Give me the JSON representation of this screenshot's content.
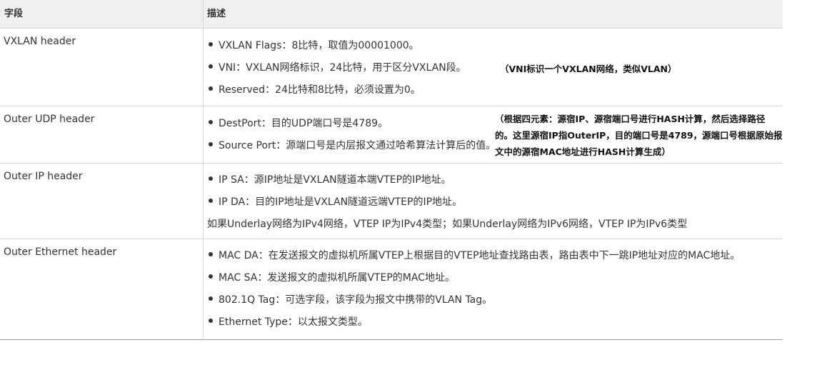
{
  "table": {
    "headers": {
      "field": "字段",
      "description": "描述"
    },
    "rows": [
      {
        "field": "VXLAN header",
        "bullets": [
          "VXLAN Flags：8比特，取值为00001000。",
          "VNI：VXLAN网络标识，24比特，用于区分VXLAN段。",
          "Reserved：24比特和8比特，必须设置为0。"
        ],
        "note": "（VNI标识一个VXLAN网络，类似VLAN）"
      },
      {
        "field": "Outer UDP header",
        "bullets": [
          "DestPort：目的UDP端口号是4789。",
          "Source Port：源端口号是内层报文通过哈希算法计算后的值。"
        ],
        "note_lines": [
          "（根据四元素：源宿IP、源宿端口号进行HASH计算，然后选择路径",
          "的。这里源宿IP指OuterIP，目的端口号是4789，源端口号根据原始报",
          "文中的源宿MAC地址进行HASH计算生成）"
        ]
      },
      {
        "field": "Outer IP header",
        "bullets": [
          "IP SA：源IP地址是VXLAN隧道本端VTEP的IP地址。",
          "IP DA：目的IP地址是VXLAN隧道远端VTEP的IP地址。"
        ],
        "extra": "如果Underlay网络为IPv4网络，VTEP IP为IPv4类型；如果Underlay网络为IPv6网络，VTEP IP为IPv6类型"
      },
      {
        "field": "Outer Ethernet header",
        "bullets": [
          "MAC DA：在发送报文的虚拟机所属VTEP上根据目的VTEP地址查找路由表，路由表中下一跳IP地址对应的MAC地址。",
          "MAC SA：发送报文的虚拟机所属VTEP的MAC地址。",
          "802.1Q Tag：可选字段，该字段为报文中携带的VLAN Tag。",
          "Ethernet Type：以太报文类型。"
        ]
      }
    ]
  }
}
